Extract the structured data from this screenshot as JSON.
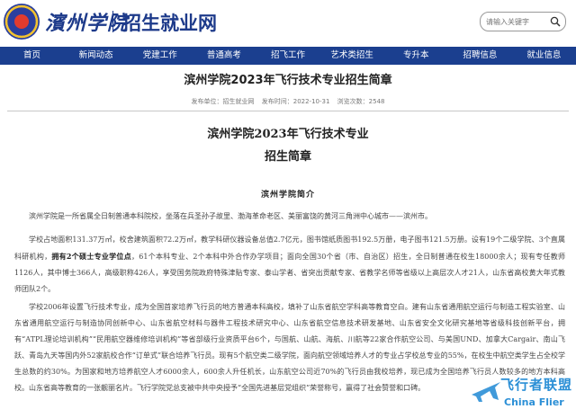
{
  "header": {
    "logo_script": "濱州学院",
    "site_title": "招生就业网",
    "search_placeholder": "请输入关键字"
  },
  "nav": {
    "items": [
      "首页",
      "新闻动态",
      "党建工作",
      "普通高考",
      "招飞工作",
      "艺术类招生",
      "专升本",
      "招聘信息",
      "就业信息"
    ]
  },
  "article": {
    "title": "滨州学院2023年飞行技术专业招生简章",
    "meta": {
      "source": "发布单位：招生就业网",
      "date": "发布时间：2022-10-31",
      "views": "浏览次数：2548"
    },
    "heading1": "滨州学院2023年飞行技术专业",
    "heading2": "招生简章",
    "subhead": "滨州学院简介",
    "p1": "滨州学院是一所省属全日制普通本科院校，坐落在兵圣孙子故里、渤海革命老区、美丽富饶的黄河三角洲中心城市——滨州市。",
    "p2_a": "学校占地面积131.37万㎡，校舍建筑面积72.2万㎡，教学科研仪器设备总值2.7亿元，图书馆纸质图书192.5万册，电子图书121.5万册。设有19个二级学院、3个直属科研机构，",
    "p2_b": "拥有2个硕士专业学位点",
    "p2_c": "，61个本科专业、2个本科中外合作办学项目；面向全国30个省（市、自治区）招生，全日制普通在校生18000余人；现有专任教师1126人，其中博士366人，高级职称426人，享受国务院政府特殊津贴专家、泰山学者、省突出贡献专家、省教学名师等省级以上高层次人才21人，山东省高校黄大年式教师团队2个。",
    "p3": "学校2006年设置飞行技术专业，成为全国首家培养飞行员的地方普通本科高校，填补了山东省航空学科高等教育空白。建有山东省通用航空运行与制造工程实验室、山东省通用航空运行与制造协同创新中心、山东省航空材料与器件工程技术研究中心、山东省航空信息技术研发基地、山东省安全文化研究基地等省级科技创新平台，拥有“ATPL理论培训机构”“民用航空器维修培训机构”等省部级行业资质平台6个，与国航、山航、海航、川航等22家合作航空公司、与美国UND、加拿大Cargair、南山飞跃、青岛九天等国内外52家航校合作“订单式”联合培养飞行员。现有5个航空类二级学院，面向航空领域培养人才的专业占学校总专业的55%，在校生中航空类学生占全校学生总数的约30%。为国家和地方培养航空人才6000余人，600余人升任机长，山东航空公司近70%的飞行员由我校培养，现已成为全国培养飞行员人数较多的地方本科高校。山东省高等教育的一张靓丽名片。飞行学院党总支被中共中央授予“全国先进基层党组织”荣誉称号，赢得了社会赞誉和口碑。"
  },
  "watermark": {
    "cn": "飞行者联盟",
    "en": "China Flier"
  },
  "colors": {
    "brand_blue": "#1b3f8f",
    "title_blue": "#1d3a8a",
    "watermark_blue": "#2b8fd6"
  }
}
